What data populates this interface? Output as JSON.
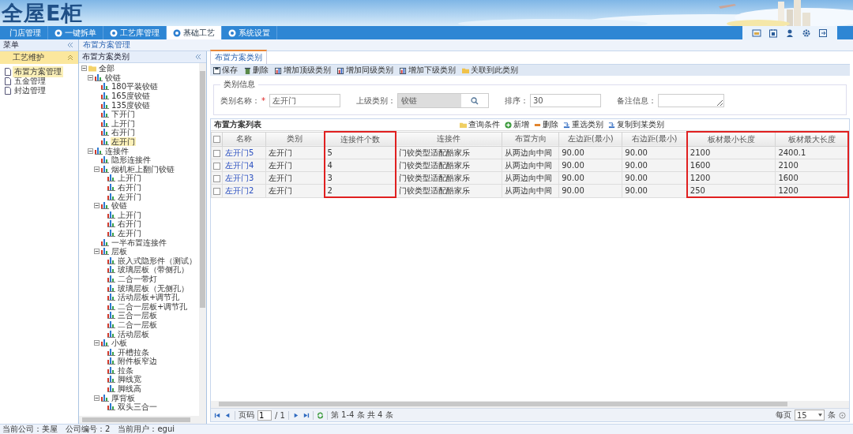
{
  "logo": "全屋E柜",
  "nav_tabs": [
    {
      "label": "门店管理",
      "selected": false,
      "icon": false
    },
    {
      "label": "一键拆单",
      "selected": false,
      "icon": true
    },
    {
      "label": "工艺库管理",
      "selected": false,
      "icon": true
    },
    {
      "label": "基础工艺",
      "selected": true,
      "icon": true
    },
    {
      "label": "系统设置",
      "selected": false,
      "icon": true
    }
  ],
  "menu": {
    "title": "菜单",
    "section": "工艺维护",
    "items": [
      {
        "label": "布置方案管理",
        "selected": true
      },
      {
        "label": "五金管理",
        "selected": false
      },
      {
        "label": "封边管理",
        "selected": false
      }
    ]
  },
  "breadcrumb": "布置方案管理",
  "tree_panel": {
    "title": "布置方案类别",
    "tree": [
      {
        "label": "全部",
        "expanded": true,
        "selected": false,
        "children": [
          {
            "label": "铰链",
            "expanded": true,
            "selected": false,
            "children": [
              {
                "label": "180平装铰链",
                "selected": false
              },
              {
                "label": "165度铰链",
                "selected": false
              },
              {
                "label": "135度铰链",
                "selected": false
              },
              {
                "label": "下开门",
                "selected": false
              },
              {
                "label": "上开门",
                "selected": false
              },
              {
                "label": "右开门",
                "selected": false
              },
              {
                "label": "左开门",
                "selected": true
              }
            ]
          },
          {
            "label": "连接件",
            "expanded": true,
            "selected": false,
            "children": [
              {
                "label": "隐形连接件",
                "selected": false
              },
              {
                "label": "烟机柜上翻门铰链",
                "expanded": true,
                "selected": false,
                "children": [
                  {
                    "label": "上开门",
                    "selected": false
                  },
                  {
                    "label": "右开门",
                    "selected": false
                  },
                  {
                    "label": "左开门",
                    "selected": false
                  }
                ]
              },
              {
                "label": "铰链",
                "expanded": true,
                "selected": false,
                "children": [
                  {
                    "label": "上开门",
                    "selected": false
                  },
                  {
                    "label": "右开门",
                    "selected": false
                  },
                  {
                    "label": "左开门",
                    "selected": false
                  }
                ]
              },
              {
                "label": "一半布置连接件",
                "selected": false
              },
              {
                "label": "层板",
                "expanded": true,
                "selected": false,
                "children": [
                  {
                    "label": "嵌入式隐形件（测试）",
                    "selected": false
                  },
                  {
                    "label": "玻璃层板（带侧孔）",
                    "selected": false
                  },
                  {
                    "label": "二合一带灯",
                    "selected": false
                  },
                  {
                    "label": "玻璃层板（无侧孔）",
                    "selected": false
                  },
                  {
                    "label": "活动层板+调节孔",
                    "selected": false
                  },
                  {
                    "label": "二合一层板+调节孔",
                    "selected": false
                  },
                  {
                    "label": "三合一层板",
                    "selected": false
                  },
                  {
                    "label": "二合一层板",
                    "selected": false
                  },
                  {
                    "label": "活动层板",
                    "selected": false
                  }
                ]
              },
              {
                "label": "小板",
                "expanded": true,
                "selected": false,
                "children": [
                  {
                    "label": "开槽拉条",
                    "selected": false
                  },
                  {
                    "label": "附件板窄边",
                    "selected": false
                  },
                  {
                    "label": "拉条",
                    "selected": false
                  },
                  {
                    "label": "脚线宽",
                    "selected": false
                  },
                  {
                    "label": "脚线高",
                    "selected": false
                  }
                ]
              },
              {
                "label": "厚背板",
                "expanded": true,
                "selected": false,
                "children": [
                  {
                    "label": "双头三合一",
                    "selected": false
                  }
                ]
              }
            ]
          }
        ]
      }
    ]
  },
  "editor": {
    "tab": "布置方案类别",
    "toolbar": [
      {
        "label": "保存",
        "kind": "save"
      },
      {
        "label": "删除",
        "kind": "delete"
      },
      {
        "label": "增加顶级类别",
        "kind": "add"
      },
      {
        "label": "增加同级类别",
        "kind": "add"
      },
      {
        "label": "增加下级类别",
        "kind": "add"
      },
      {
        "label": "关联到此类别",
        "kind": "link"
      }
    ],
    "legend": "类别信息",
    "fields": [
      {
        "label": "类别名称：",
        "required_mark": "*",
        "value": "左开门",
        "kind": "text"
      },
      {
        "label": "上级类别：",
        "value": "铰链",
        "kind": "lookup"
      },
      {
        "label": "排序：",
        "value": "30",
        "kind": "text"
      },
      {
        "label": "备注信息：",
        "kind": "textarea"
      }
    ]
  },
  "list": {
    "title": "布置方案列表",
    "all_checked": false,
    "actions": [
      {
        "label": "查询条件",
        "kind": "query"
      },
      {
        "label": "新增",
        "kind": "add"
      },
      {
        "label": "删除",
        "kind": "delete"
      },
      {
        "label": "重选类别",
        "kind": "move"
      },
      {
        "label": "复制到某类别",
        "kind": "move"
      }
    ],
    "columns": [
      {
        "label": "名称",
        "marked": false
      },
      {
        "label": "类别",
        "marked": false
      },
      {
        "label": "连接件个数",
        "marked": true
      },
      {
        "label": "连接件",
        "marked": false
      },
      {
        "label": "布置方向",
        "marked": false
      },
      {
        "label": "左边距(最小)",
        "marked": false
      },
      {
        "label": "右边距(最小)",
        "marked": false
      },
      {
        "label": "板材最小长度",
        "marked": true
      },
      {
        "label": "板材最大长度",
        "marked": true
      }
    ],
    "rows": [
      {
        "checked": false,
        "cells": [
          "左开门5",
          "左开门",
          "5",
          "门铰类型适配酷家乐",
          "从两边向中间",
          "90.00",
          "90.00",
          "2100",
          "2400.1"
        ]
      },
      {
        "checked": false,
        "cells": [
          "左开门4",
          "左开门",
          "4",
          "门铰类型适配酷家乐",
          "从两边向中间",
          "90.00",
          "90.00",
          "1600",
          "2100"
        ]
      },
      {
        "checked": false,
        "cells": [
          "左开门3",
          "左开门",
          "3",
          "门铰类型适配酷家乐",
          "从两边向中间",
          "90.00",
          "90.00",
          "1200",
          "1600"
        ]
      },
      {
        "checked": false,
        "cells": [
          "左开门2",
          "左开门",
          "2",
          "门铰类型适配酷家乐",
          "从两边向中间",
          "90.00",
          "90.00",
          "250",
          "1200"
        ]
      }
    ],
    "pager": {
      "page_label": "页码",
      "page": "1",
      "of": "/ 1",
      "range": "第 1-4 条  共 4 条",
      "per_page_label": "每页",
      "per_page": "15",
      "unit": "条"
    }
  },
  "status_bar": [
    {
      "label": "当前公司：",
      "value": "美屋"
    },
    {
      "label": "公司编号：",
      "value": "2"
    },
    {
      "label": "当前用户：",
      "value": "egui"
    }
  ]
}
